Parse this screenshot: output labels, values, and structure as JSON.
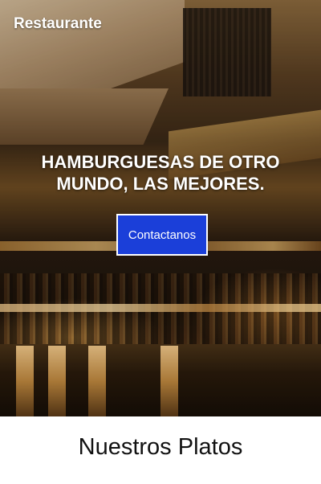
{
  "nav": {
    "brand": "Restaurante"
  },
  "hero": {
    "headline": "HAMBURGUESAS DE OTRO MUNDO, LAS MEJORES.",
    "cta_label": "Contactanos",
    "cta_color": "#1b3fd9"
  },
  "section": {
    "title": "Nuestros Platos"
  }
}
